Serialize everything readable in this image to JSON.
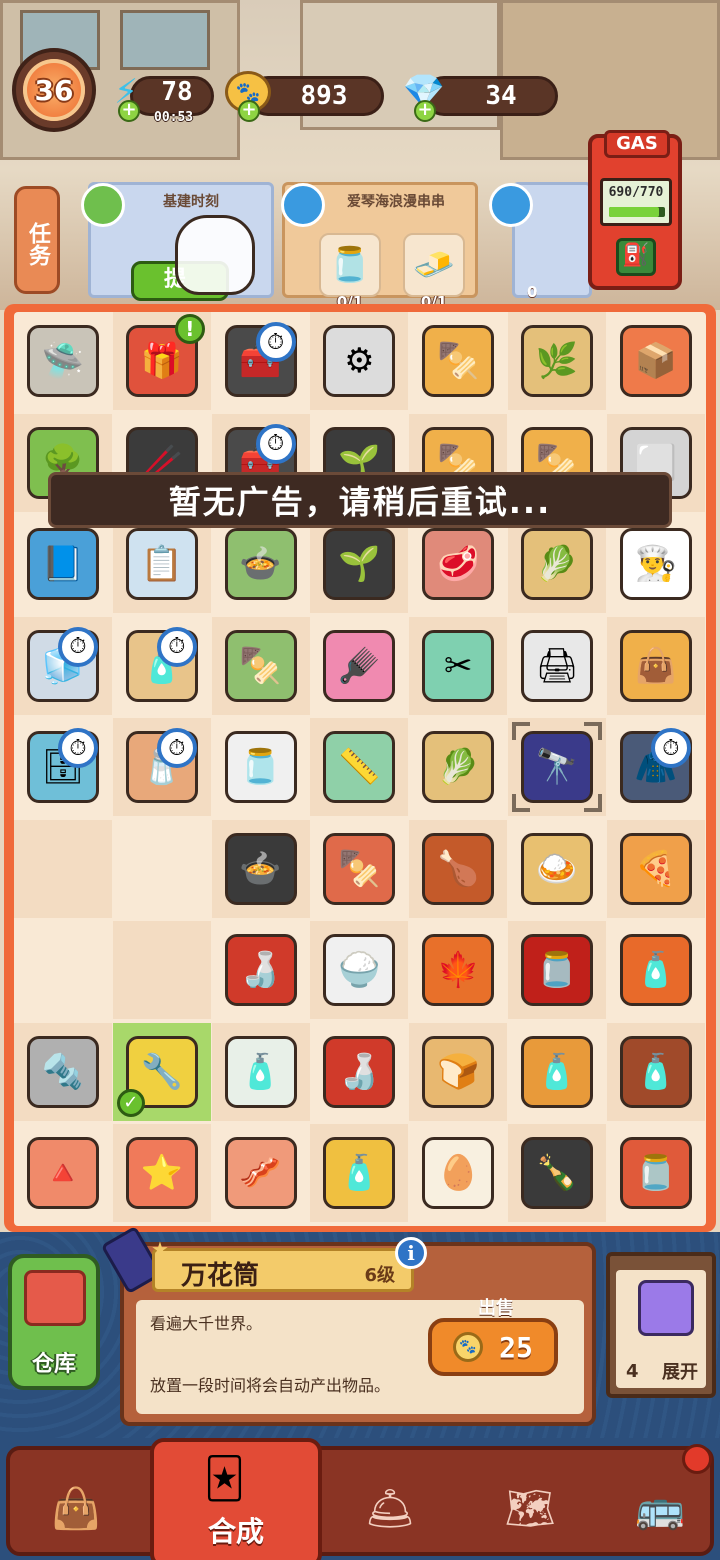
{
  "header": {
    "level": "36",
    "energy": {
      "value": "78",
      "timer": "00:53",
      "icon": "lightning-icon"
    },
    "coins": {
      "value": "893",
      "icon": "paw-coin-icon"
    },
    "gems": {
      "value": "34",
      "icon": "gem-icon"
    }
  },
  "tasks": {
    "tab_label": "任务",
    "cards": [
      {
        "title": "基建时刻",
        "button_label": "提",
        "icon": "paint-roller-icon"
      },
      {
        "title": "爱琴海浪漫串串",
        "icon": "shop-icon",
        "requirements": [
          {
            "name": "jar",
            "count": "0/1"
          },
          {
            "name": "tofu",
            "count": "0/1"
          }
        ]
      },
      {
        "title": "",
        "icon": "paint-roller-icon",
        "count": "0"
      }
    ]
  },
  "gas": {
    "label": "GAS",
    "value": "690/770",
    "fill": 0.896
  },
  "toast": "暂无广告，请稍后重试...",
  "board": {
    "rows": [
      [
        {
          "name": "drone-icon",
          "g": "🛸",
          "c": "#c9c4b8"
        },
        {
          "name": "lucky-box-icon",
          "g": "🎁",
          "c": "#e0523c",
          "alert": true
        },
        {
          "name": "tools-bundle-icon",
          "g": "🧰",
          "c": "#4a4a4a",
          "clock": true
        },
        {
          "name": "gear-icon",
          "g": "⚙",
          "c": "#dcdcdc"
        },
        {
          "name": "skewer-box-icon",
          "g": "🍢",
          "c": "#f0b04a"
        },
        {
          "name": "herb-tray-icon",
          "g": "🌿",
          "c": "#e4c07a"
        },
        {
          "name": "crate-icon",
          "g": "📦",
          "c": "#ef7a4a"
        }
      ],
      [
        {
          "name": "tree-icon",
          "g": "🌳",
          "c": "#7fbf4f"
        },
        {
          "name": "seaweed-roll-icon",
          "g": "🥢",
          "c": "#3b3b3b"
        },
        {
          "name": "tools-bundle-icon",
          "g": "🧰",
          "c": "#4a4a4a",
          "clock": true
        },
        {
          "name": "seaweed-sprout-icon",
          "g": "🌱",
          "c": "#3b3b3b"
        },
        {
          "name": "skewer-box-icon",
          "g": "🍢",
          "c": "#f0b04a"
        },
        {
          "name": "skewer-box-icon",
          "g": "🍢",
          "c": "#f0b04a"
        },
        {
          "name": "stone-icon",
          "g": "⬜",
          "c": "#d4d4d4"
        }
      ],
      [
        {
          "name": "notebook-icon",
          "g": "📘",
          "c": "#4aa0d8"
        },
        {
          "name": "notepad-icon",
          "g": "📋",
          "c": "#cfe2f0"
        },
        {
          "name": "rice-cooker-icon",
          "g": "🍲",
          "c": "#8fbf6f"
        },
        {
          "name": "seaweed-sprout-icon",
          "g": "🌱",
          "c": "#3b3b3b"
        },
        {
          "name": "minced-meat-icon",
          "g": "🥩",
          "c": "#e08a7a"
        },
        {
          "name": "cutting-board-herbs-icon",
          "g": "🥬",
          "c": "#e4c07a"
        },
        {
          "name": "chef-hat-icon",
          "g": "👨‍🍳",
          "c": "#ffffff"
        }
      ],
      [
        {
          "name": "fridge-icon",
          "g": "🧊",
          "c": "#d0dbe6",
          "clock": true
        },
        {
          "name": "shelf-icon",
          "g": "🧴",
          "c": "#e8c48a",
          "clock": true
        },
        {
          "name": "skewer-pot-icon",
          "g": "🍢",
          "c": "#8fbf6f"
        },
        {
          "name": "hair-brush-icon",
          "g": "🪮",
          "c": "#f08ab0"
        },
        {
          "name": "scissors-icon",
          "g": "✂",
          "c": "#7fd0b0"
        },
        {
          "name": "printer-icon",
          "g": "🖨",
          "c": "#e8e8e8"
        },
        {
          "name": "shopping-bag-icon",
          "g": "👜",
          "c": "#f0b04a"
        }
      ],
      [
        {
          "name": "cabinet-icon",
          "g": "🗄",
          "c": "#6fbfd8",
          "clock": true
        },
        {
          "name": "spice-rack-icon",
          "g": "🧂",
          "c": "#e8a87a",
          "clock": true
        },
        {
          "name": "sugar-jar-icon",
          "g": "🫙",
          "c": "#f0f0f0"
        },
        {
          "name": "ruler-icon",
          "g": "📏",
          "c": "#8fd0a8"
        },
        {
          "name": "cutting-board-herbs-icon",
          "g": "🥬",
          "c": "#e4c07a"
        },
        {
          "name": "kaleidoscope-icon",
          "g": "🔭",
          "c": "#3a3a8a",
          "selected": true
        },
        {
          "name": "chef-apron-icon",
          "g": "🧥",
          "c": "#4a5a78",
          "clock": true
        }
      ],
      [
        null,
        null,
        {
          "name": "stew-pot-icon",
          "g": "🍲",
          "c": "#3a3a3a"
        },
        {
          "name": "grilled-skewers-icon",
          "g": "🍢",
          "c": "#e06a4a"
        },
        {
          "name": "roast-chicken-icon",
          "g": "🍗",
          "c": "#c45a2a"
        },
        {
          "name": "curry-dish-icon",
          "g": "🍛",
          "c": "#e8c070"
        },
        {
          "name": "pizza-icon",
          "g": "🍕",
          "c": "#f0a04a"
        }
      ],
      [
        null,
        null,
        {
          "name": "hot-sauce-webbed-icon",
          "g": "🍶",
          "c": "#d03a2a"
        },
        {
          "name": "rice-plate-icon",
          "g": "🍚",
          "c": "#f0f0f0"
        },
        {
          "name": "leaf-wreath-icon",
          "g": "🍁",
          "c": "#e8702a"
        },
        {
          "name": "chili-jar-icon",
          "g": "🫙",
          "c": "#c0201a"
        },
        {
          "name": "sauce-bottle-icon",
          "g": "🧴",
          "c": "#e86a2a"
        }
      ],
      [
        {
          "name": "screw-icon",
          "g": "🔩",
          "c": "#b0b0b0"
        },
        {
          "name": "pliers-icon",
          "g": "🔧",
          "c": "#f0d040",
          "checked": true
        },
        {
          "name": "glue-502-icon",
          "g": "🧴",
          "c": "#e8f0e8"
        },
        {
          "name": "hot-sauce-webbed-icon",
          "g": "🍶",
          "c": "#d03a2a"
        },
        {
          "name": "green-onion-toast-icon",
          "g": "🍞",
          "c": "#e8b870"
        },
        {
          "name": "sauce-bottle-icon",
          "g": "🧴",
          "c": "#e89a3a"
        },
        {
          "name": "soy-sauce-icon",
          "g": "🧴",
          "c": "#a04a2a"
        }
      ],
      [
        {
          "name": "cookie-triangle-icon",
          "g": "🔺",
          "c": "#f08a6a"
        },
        {
          "name": "cookie-star-icon",
          "g": "⭐",
          "c": "#f07a5a"
        },
        {
          "name": "ham-slice-icon",
          "g": "🥓",
          "c": "#f09a7a"
        },
        {
          "name": "small-sauce-icon",
          "g": "🧴",
          "c": "#f0c040"
        },
        {
          "name": "boiled-egg-icon",
          "g": "🥚",
          "c": "#f8f0e0"
        },
        {
          "name": "vinegar-icon",
          "g": "🍾",
          "c": "#3a3a3a"
        },
        {
          "name": "pickle-jar-icon",
          "g": "🫙",
          "c": "#e05a3a"
        }
      ]
    ]
  },
  "item_panel": {
    "name": "万花筒",
    "level": "6级",
    "description_1": "看遍大千世界。",
    "description_2": "放置一段时间将会自动产出物品。",
    "sell_label": "出售",
    "sell_price": "25"
  },
  "warehouse": {
    "label": "仓库"
  },
  "expand": {
    "count": "4",
    "label": "展开"
  },
  "nav": {
    "items": [
      {
        "name": "shop-bag-icon",
        "glyph": "👜"
      },
      {
        "name": "merge-icon",
        "label": "合成",
        "glyph": "🃏"
      },
      {
        "name": "cloche-icon",
        "glyph": "🛎"
      },
      {
        "name": "map-icon",
        "glyph": "🗺"
      },
      {
        "name": "bus-icon",
        "glyph": "🚌"
      }
    ]
  }
}
